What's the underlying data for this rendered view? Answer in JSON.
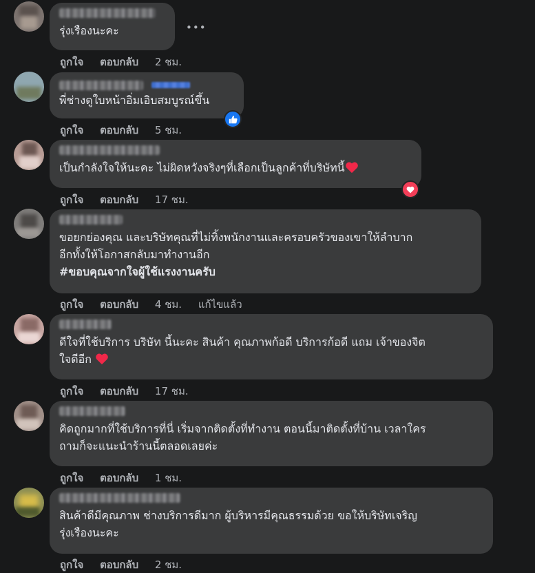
{
  "actions": {
    "like": "ถูกใจ",
    "reply": "ตอบกลับ",
    "edited": "แก้ไขแล้ว"
  },
  "comments": [
    {
      "text": "รุ่งเรืองนะคะ",
      "time": "2 ชม."
    },
    {
      "text": "พี่ช่างดูใบหน้าอิ่มเอิบสมบูรณ์ขึ้น",
      "time": "5 ชม.",
      "reaction": "like-icon"
    },
    {
      "text": "เป็นกำลังใจให้นะคะ ไม่ผิดหวังจริงๆที่เลือกเป็นลูกค้าที่บริษัทนี้",
      "time": "17 ชม.",
      "reaction": "heart-icon"
    },
    {
      "line1": "ขอยกย่องคุณ และบริษัทคุณที่ไม่ทิ้งพนักงานและครอบครัวของเขาให้ลำบาก",
      "line2": "อีกทั้งให้โอกาสกลับมาทำงานอีก",
      "hashtag": "#ขอบคุณจากใจผู้ใช้แรงงานครับ",
      "time": "4 ชม."
    },
    {
      "line1": "ดีใจที่ใช้บริการ บริษัท นี้นะคะ สินค้า คุณภาพก้อดี บริการก้อดี แถม เจ้าของจิต",
      "line2": "ใจดีอีก",
      "time": "17 ชม."
    },
    {
      "line1": "คิดถูกมากที่ใช้บริการที่นี่ เริ่มจากติดตั้งที่ทำงาน ตอนนี้มาติดตั้งที่บ้าน เวลาใคร",
      "line2": "ถามก็จะแนะนำร้านนี้ตลอดเลยค่ะ",
      "time": "1 ชม."
    },
    {
      "line1": "สินค้าดีมีคุณภาพ ช่างบริการดีมาก ผู้บริหารมีคุณธรรมด้วย ขอให้บริษัทเจริญ",
      "line2": "รุ่งเรืองนะคะ",
      "time": "2 ชม."
    }
  ],
  "colors": {
    "background": "#18191a",
    "bubble": "#3a3b3c",
    "text": "#e4e6eb",
    "muted": "#b0b3b8",
    "like": "#1877f2",
    "heart": "#f33e58"
  }
}
